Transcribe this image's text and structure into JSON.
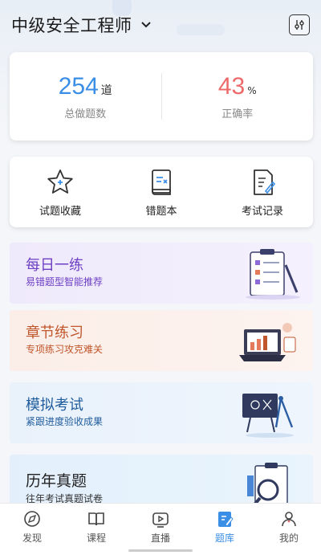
{
  "header": {
    "title": "中级安全工程师"
  },
  "stats": {
    "total": {
      "value": "254",
      "unit": "道",
      "label": "总做题数"
    },
    "accuracy": {
      "value": "43",
      "unit": "%",
      "label": "正确率"
    }
  },
  "quick_actions": [
    {
      "label": "试题收藏",
      "icon": "star-icon"
    },
    {
      "label": "错题本",
      "icon": "wrong-book-icon"
    },
    {
      "label": "考试记录",
      "icon": "exam-record-icon"
    }
  ],
  "features": [
    {
      "title": "每日一练",
      "subtitle": "易错题型智能推荐"
    },
    {
      "title": "章节练习",
      "subtitle": "专项练习攻克难关"
    },
    {
      "title": "模拟考试",
      "subtitle": "紧跟进度验收成果"
    },
    {
      "title": "历年真题",
      "subtitle": "往年考试真题试卷"
    }
  ],
  "tabs": [
    {
      "label": "发现",
      "icon": "discover-icon"
    },
    {
      "label": "课程",
      "icon": "course-icon"
    },
    {
      "label": "直播",
      "icon": "live-icon"
    },
    {
      "label": "题库",
      "icon": "question-bank-icon",
      "active": true
    },
    {
      "label": "我的",
      "icon": "profile-icon"
    }
  ],
  "colors": {
    "accent": "#3a8ee6",
    "accuracy": "#ee6a6a",
    "daily": "#6e3fc4",
    "chapter": "#c0562c",
    "mock": "#1f5c9c"
  }
}
